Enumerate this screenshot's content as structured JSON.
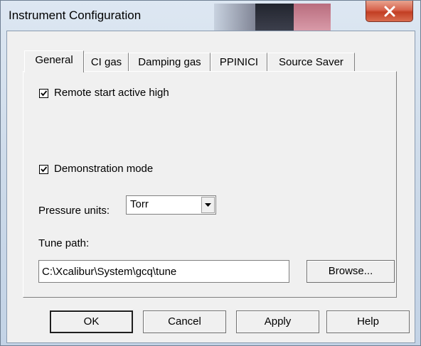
{
  "window": {
    "title": "Instrument Configuration",
    "close_label": "X"
  },
  "tabs": [
    {
      "label": "General",
      "active": true
    },
    {
      "label": "CI gas",
      "active": false
    },
    {
      "label": "Damping gas",
      "active": false
    },
    {
      "label": "PPINICI",
      "active": false
    },
    {
      "label": "Source Saver",
      "active": false
    }
  ],
  "general": {
    "remote_start": {
      "label": "Remote start active high",
      "checked": true
    },
    "demo_mode": {
      "label": "Demonstration mode",
      "checked": true
    },
    "pressure_units": {
      "label": "Pressure units:",
      "value": "Torr"
    },
    "tune_path": {
      "label": "Tune path:",
      "value": "C:\\Xcalibur\\System\\gcq\\tune"
    },
    "browse_label": "Browse..."
  },
  "buttons": {
    "ok": "OK",
    "cancel": "Cancel",
    "apply": "Apply",
    "help": "Help"
  },
  "colors": {
    "close_button": "#c9432a",
    "dialog_face": "#f0f0f0",
    "title_bar": "#cad8e8"
  }
}
